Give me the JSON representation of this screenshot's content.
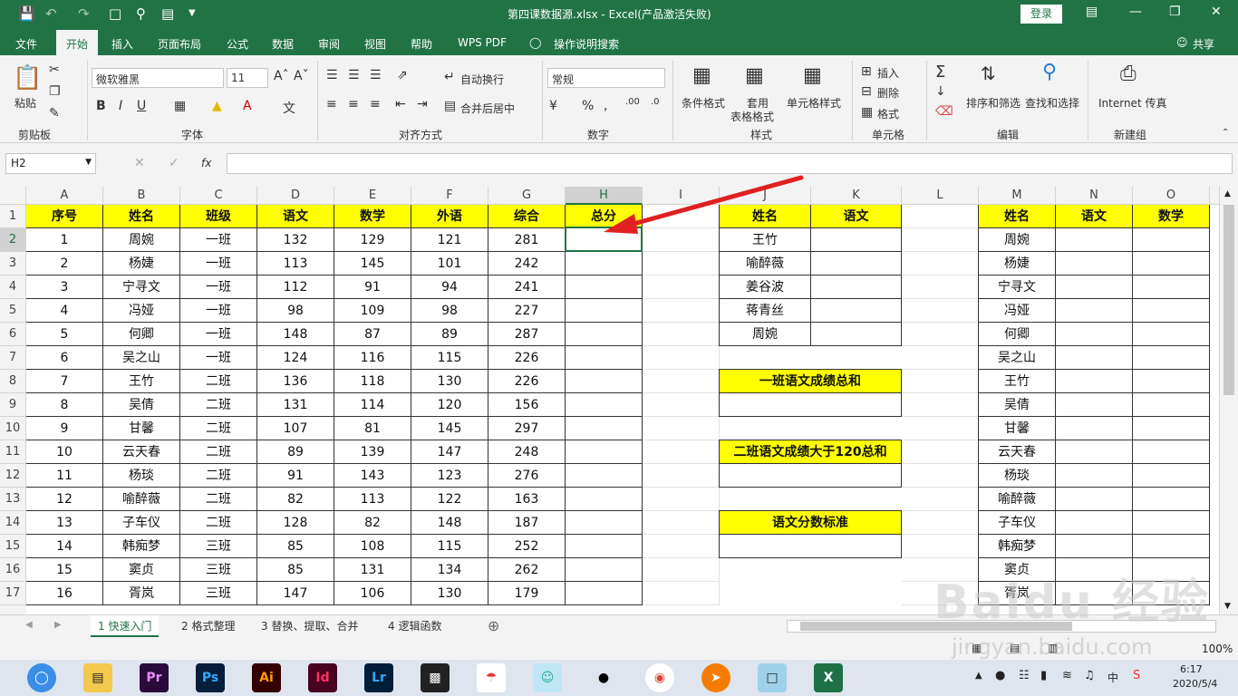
{
  "titlebar": {
    "title": "第四课数据源.xlsx  -  Excel(产品激活失败)",
    "login": "登录"
  },
  "tabs": [
    "文件",
    "开始",
    "插入",
    "页面布局",
    "公式",
    "数据",
    "审阅",
    "视图",
    "帮助",
    "WPS PDF",
    "操作说明搜索"
  ],
  "share": "共享",
  "ribbon": {
    "paste": "粘贴",
    "clipboard": "剪贴板",
    "font_name": "微软雅黑",
    "font_size": "11",
    "font": "字体",
    "wrap": "自动换行",
    "merge": "合并后居中",
    "align": "对齐方式",
    "numfmt": "常规",
    "number": "数字",
    "cond": "条件格式",
    "table1": "套用",
    "table2": "表格格式",
    "cellstyle": "单元格样式",
    "styles": "样式",
    "insert": "插入",
    "delete": "删除",
    "format": "格式",
    "cells": "单元格",
    "sort": "排序和筛选",
    "find": "查找和选择",
    "edit": "编辑",
    "internet": "Internet 传真",
    "newgroup": "新建组"
  },
  "formula": {
    "namebox": "H2",
    "fx": "fx"
  },
  "columns": [
    "A",
    "B",
    "C",
    "D",
    "E",
    "F",
    "G",
    "H",
    "I",
    "J",
    "K",
    "L",
    "M",
    "N",
    "O"
  ],
  "rows": [
    "1",
    "2",
    "3",
    "4",
    "5",
    "6",
    "7",
    "8",
    "9",
    "10",
    "11",
    "12",
    "13",
    "14",
    "15",
    "16",
    "17"
  ],
  "main_headers": [
    "序号",
    "姓名",
    "班级",
    "语文",
    "数学",
    "外语",
    "综合",
    "总分"
  ],
  "main_rows": [
    [
      "1",
      "周婉",
      "一班",
      "132",
      "129",
      "121",
      "281"
    ],
    [
      "2",
      "杨婕",
      "一班",
      "113",
      "145",
      "101",
      "242"
    ],
    [
      "3",
      "宁寻文",
      "一班",
      "112",
      "91",
      "94",
      "241"
    ],
    [
      "4",
      "冯娅",
      "一班",
      "98",
      "109",
      "98",
      "227"
    ],
    [
      "5",
      "何卿",
      "一班",
      "148",
      "87",
      "89",
      "287"
    ],
    [
      "6",
      "吴之山",
      "一班",
      "124",
      "116",
      "115",
      "226"
    ],
    [
      "7",
      "王竹",
      "二班",
      "136",
      "118",
      "130",
      "226"
    ],
    [
      "8",
      "吴倩",
      "二班",
      "131",
      "114",
      "120",
      "156"
    ],
    [
      "9",
      "甘馨",
      "二班",
      "107",
      "81",
      "145",
      "297"
    ],
    [
      "10",
      "云天春",
      "二班",
      "89",
      "139",
      "147",
      "248"
    ],
    [
      "11",
      "杨琰",
      "二班",
      "91",
      "143",
      "123",
      "276"
    ],
    [
      "12",
      "喻醉薇",
      "二班",
      "82",
      "113",
      "122",
      "163"
    ],
    [
      "13",
      "子车仪",
      "二班",
      "128",
      "82",
      "148",
      "187"
    ],
    [
      "14",
      "韩痴梦",
      "三班",
      "85",
      "108",
      "115",
      "252"
    ],
    [
      "15",
      "窦贞",
      "三班",
      "85",
      "131",
      "134",
      "262"
    ],
    [
      "16",
      "胥岚",
      "三班",
      "147",
      "106",
      "130",
      "179"
    ]
  ],
  "jk_headers": [
    "姓名",
    "语文"
  ],
  "jk_names": [
    "王竹",
    "喻醉薇",
    "姜谷波",
    "蒋青丝",
    "周婉"
  ],
  "box1": "一班语文成绩总和",
  "box2": "二班语文成绩大于120总和",
  "box3": "语文分数标准",
  "mo_headers": [
    "姓名",
    "语文",
    "数学"
  ],
  "mo_names": [
    "周婉",
    "杨婕",
    "宁寻文",
    "冯娅",
    "何卿",
    "吴之山",
    "王竹",
    "吴倩",
    "甘馨",
    "云天春",
    "杨琰",
    "喻醉薇",
    "子车仪",
    "韩痴梦",
    "窦贞",
    "胥岚"
  ],
  "sheets": [
    "1 快速入门",
    "2 格式整理",
    "3 替换、提取、合并",
    "4 逻辑函数"
  ],
  "status": {
    "zoom": "100%"
  },
  "clock": {
    "time": "6:17",
    "date": "2020/5/4",
    "ime": "中"
  },
  "watermark": "Baidu 经验",
  "watermark2": "jingyan.baidu.com",
  "colors": {
    "excel_green": "#217346",
    "yellow": "#ffff00",
    "arrow": "#e02020"
  }
}
